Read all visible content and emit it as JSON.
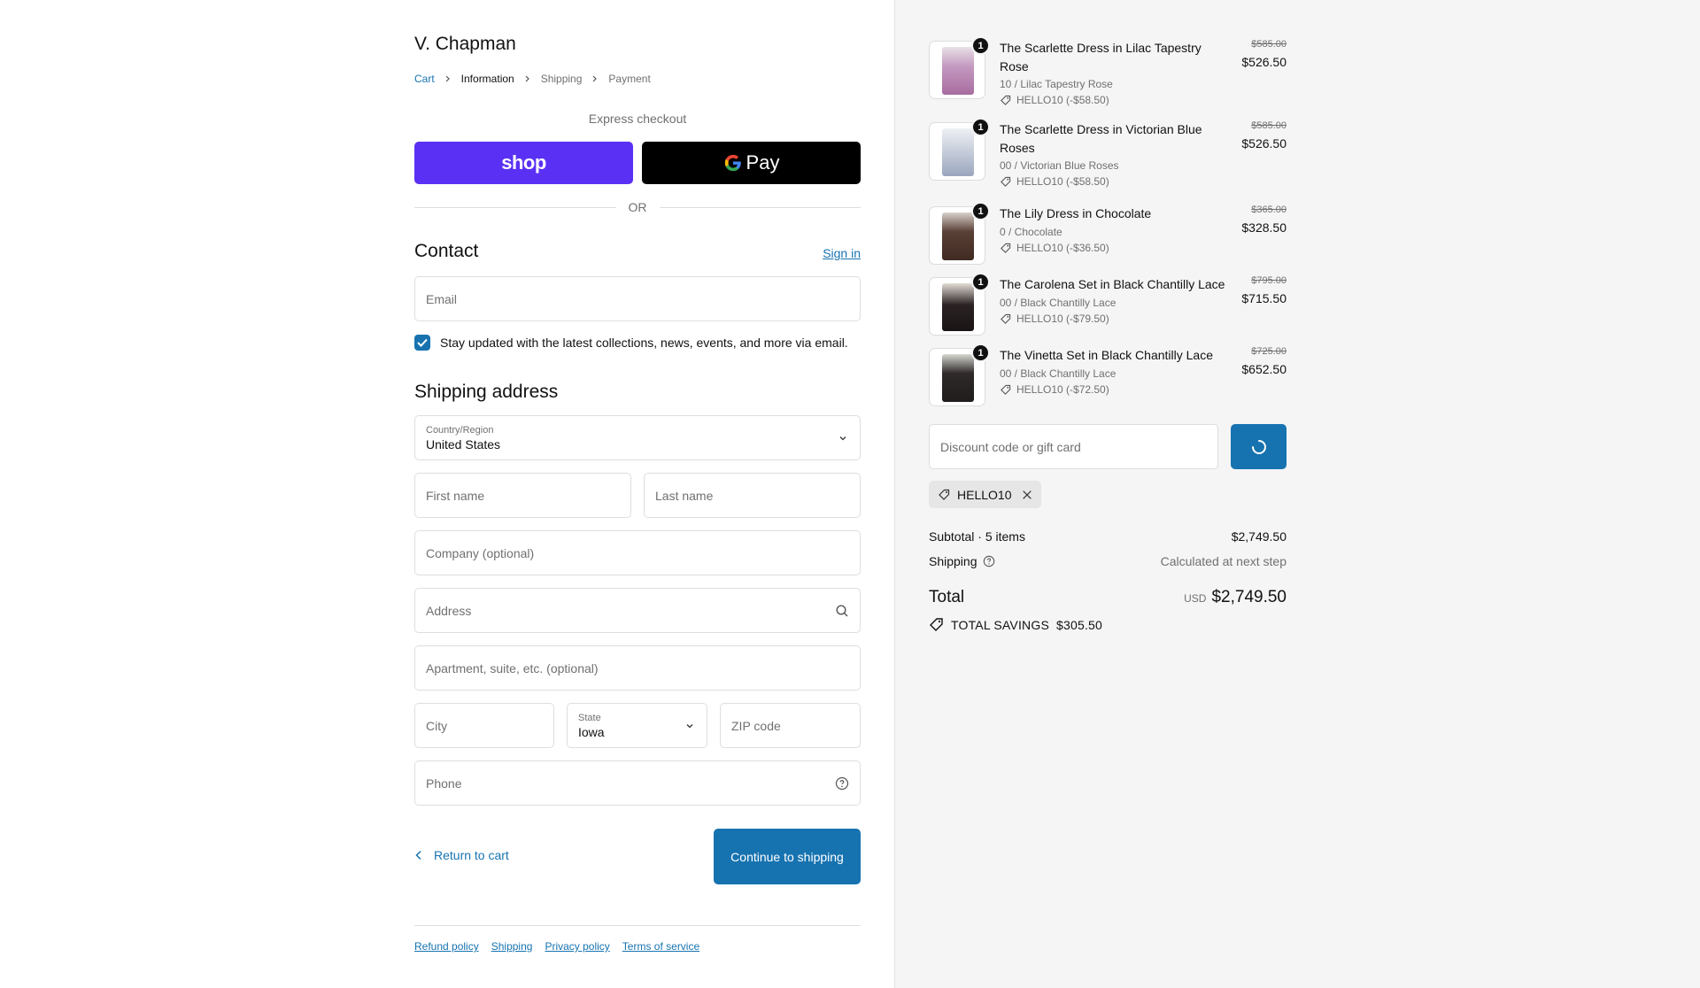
{
  "store": {
    "name": "V. Chapman"
  },
  "breadcrumb": [
    {
      "label": "Cart"
    },
    {
      "label": "Information"
    },
    {
      "label": "Shipping"
    },
    {
      "label": "Payment"
    }
  ],
  "express": {
    "label": "Express checkout",
    "shop_label": "shop",
    "gpay_label": "Pay",
    "or_label": "OR"
  },
  "contact": {
    "title": "Contact",
    "signin": "Sign in",
    "email_placeholder": "Email",
    "newsletter_label": "Stay updated with the latest collections, news, events, and more via email.",
    "newsletter_checked": true
  },
  "shipping": {
    "title": "Shipping address",
    "country_label": "Country/Region",
    "country_value": "United States",
    "first_name": "First name",
    "last_name": "Last name",
    "company": "Company (optional)",
    "address": "Address",
    "apartment": "Apartment, suite, etc. (optional)",
    "city": "City",
    "state_label": "State",
    "state_value": "Iowa",
    "zip": "ZIP code",
    "phone": "Phone"
  },
  "actions": {
    "return": "Return to cart",
    "continue": "Continue to shipping"
  },
  "footer": [
    {
      "label": "Refund policy"
    },
    {
      "label": "Shipping"
    },
    {
      "label": "Privacy policy"
    },
    {
      "label": "Terms of service"
    }
  ],
  "cart": {
    "items": [
      {
        "name": "The Scarlette Dress in Lilac Tapestry Rose",
        "variant": "10 / Lilac Tapestry Rose",
        "discount": "HELLO10 (-$58.50)",
        "old_price": "$585.00",
        "price": "$526.50",
        "qty": "1",
        "color": "#b98cb6"
      },
      {
        "name": "The Scarlette Dress in Victorian Blue Roses",
        "variant": "00 / Victorian Blue Roses",
        "discount": "HELLO10 (-$58.50)",
        "old_price": "$585.00",
        "price": "$526.50",
        "qty": "1",
        "color": "#c9cfdc"
      },
      {
        "name": "The Lily Dress in Chocolate",
        "variant": "0 / Chocolate",
        "discount": "HELLO10 (-$36.50)",
        "old_price": "$365.00",
        "price": "$328.50",
        "qty": "1",
        "color": "#3f2a22"
      },
      {
        "name": "The Carolena Set in Black Chantilly Lace",
        "variant": "00 / Black Chantilly Lace",
        "discount": "HELLO10 (-$79.50)",
        "old_price": "$795.00",
        "price": "$715.50",
        "qty": "1",
        "color": "#2b2323"
      },
      {
        "name": "The Vinetta Set in Black Chantilly Lace",
        "variant": "00 / Black Chantilly Lace",
        "discount": "HELLO10 (-$72.50)",
        "old_price": "$725.00",
        "price": "$652.50",
        "qty": "1",
        "color": "#1f1c1c"
      }
    ],
    "discount_placeholder": "Discount code or gift card",
    "applied_code": "HELLO10",
    "subtotal_label": "Subtotal · 5 items",
    "subtotal_value": "$2,749.50",
    "shipping_label": "Shipping",
    "shipping_value": "Calculated at next step",
    "total_label": "Total",
    "total_currency": "USD",
    "total_value": "$2,749.50",
    "savings_label": "TOTAL SAVINGS",
    "savings_value": "$305.50"
  },
  "colors": {
    "accent": "#1773b0",
    "shop_pay": "#5a31f4"
  }
}
